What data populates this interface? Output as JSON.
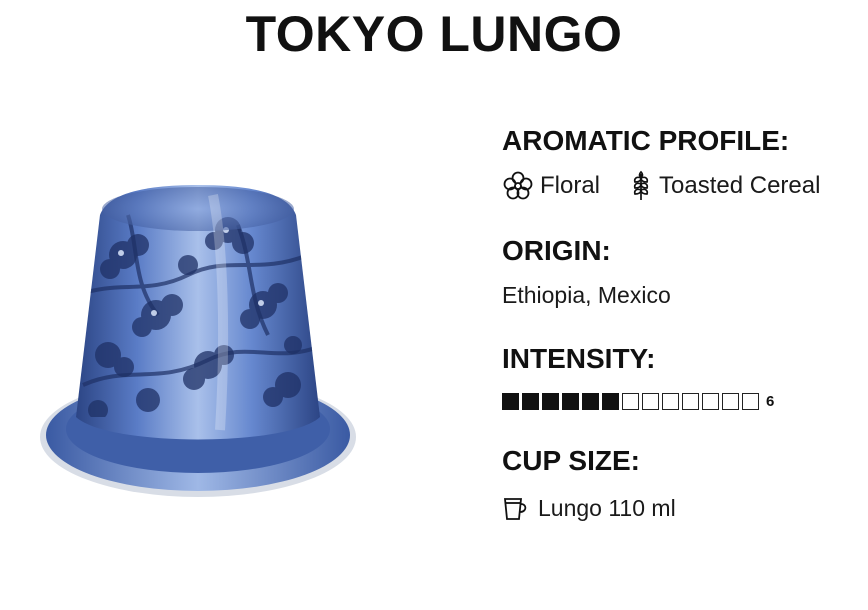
{
  "product": {
    "title": "TOKYO LUNGO"
  },
  "aromatic_profile": {
    "heading": "AROMATIC PROFILE:",
    "notes": [
      {
        "label": "Floral",
        "icon": "flower-icon"
      },
      {
        "label": "Toasted Cereal",
        "icon": "wheat-icon"
      }
    ]
  },
  "origin": {
    "heading": "ORIGIN:",
    "value": "Ethiopia, Mexico"
  },
  "intensity": {
    "heading": "INTENSITY:",
    "value": 6,
    "max": 13,
    "value_label": "6"
  },
  "cup_size": {
    "heading": "CUP SIZE:",
    "icon": "cup-icon",
    "value": "Lungo 110 ml"
  },
  "colors": {
    "capsule_blue": "#4f6fb8",
    "capsule_dark": "#1f3166",
    "text": "#111111"
  }
}
